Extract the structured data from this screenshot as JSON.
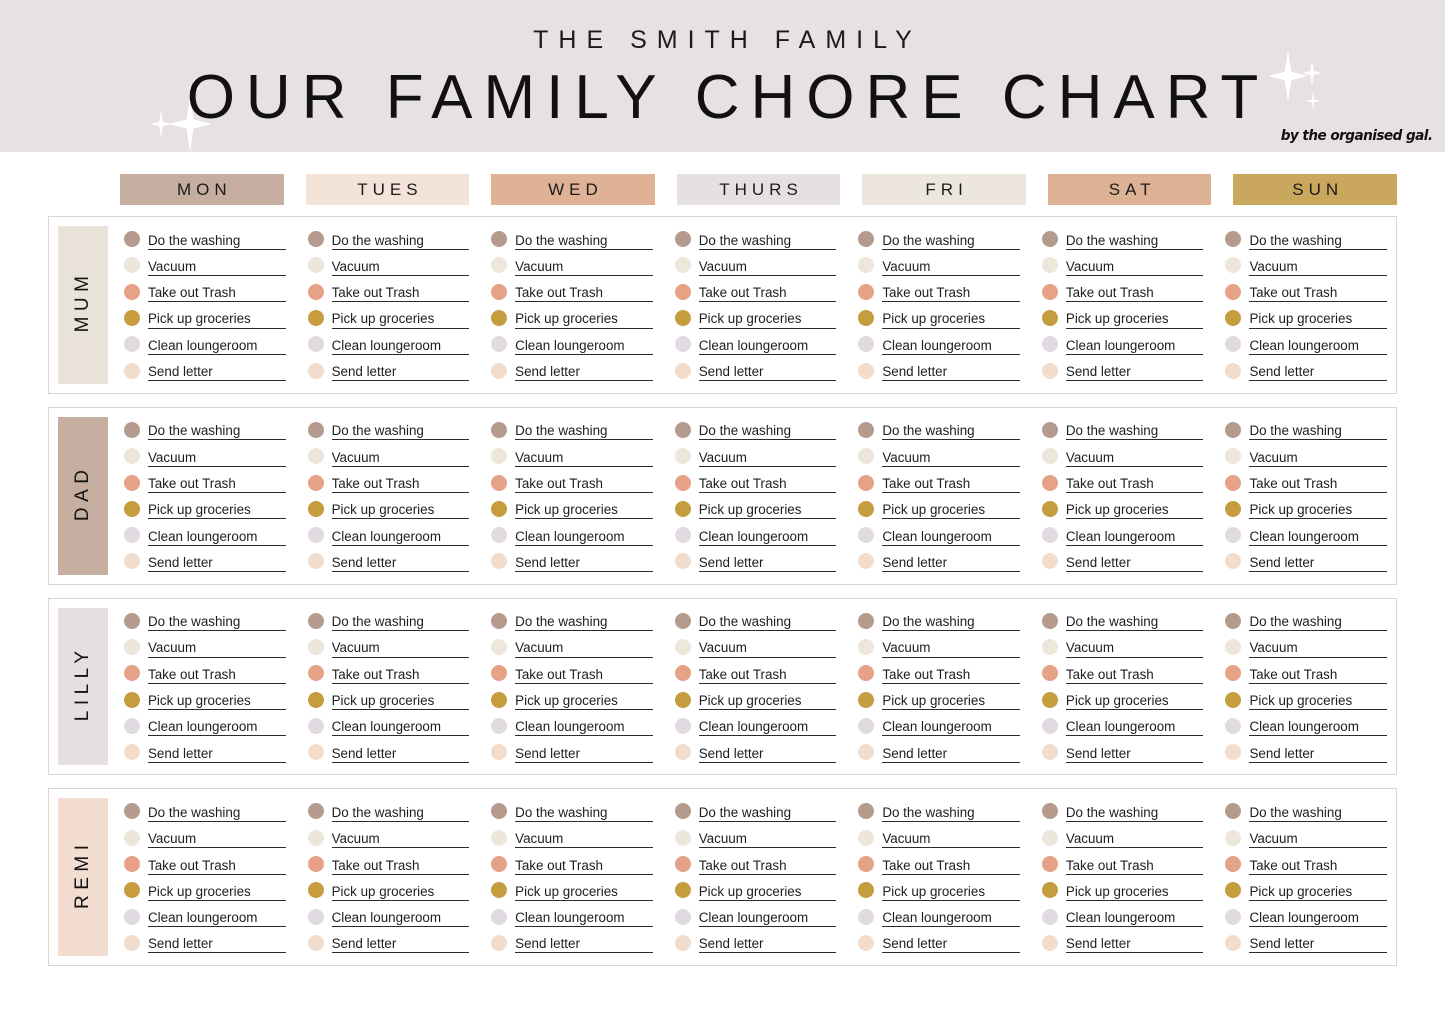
{
  "header": {
    "subtitle": "THE SMITH FAMILY",
    "title": "OUR FAMILY CHORE CHART",
    "brand": "by the organised gal.",
    "background_color": "#e7e1e4",
    "sparkle_color": "#ffffff"
  },
  "days": [
    {
      "label": "MON",
      "color": "#c5ad9f"
    },
    {
      "label": "TUES",
      "color": "#f3e3d9"
    },
    {
      "label": "WED",
      "color": "#dfb195"
    },
    {
      "label": "THURS",
      "color": "#e6e0e3"
    },
    {
      "label": "FRI",
      "color": "#ece6dd"
    },
    {
      "label": "SAT",
      "color": "#ddb194"
    },
    {
      "label": "SUN",
      "color": "#c9a85e"
    }
  ],
  "chores": [
    {
      "label": "Do the washing",
      "dot_color": "#b49b8e"
    },
    {
      "label": "Vacuum",
      "dot_color": "#ece6db"
    },
    {
      "label": "Take out Trash",
      "dot_color": "#e5a287"
    },
    {
      "label": "Pick up groceries",
      "dot_color": "#c59d3f"
    },
    {
      "label": "Clean loungeroom",
      "dot_color": "#e1dbe1"
    },
    {
      "label": "Send letter",
      "dot_color": "#f2ddcd"
    }
  ],
  "people": [
    {
      "name": "MUM",
      "tile_color": "#e8e2d8"
    },
    {
      "name": "DAD",
      "tile_color": "#c5ad9f"
    },
    {
      "name": "LILLY",
      "tile_color": "#e5dfe2"
    },
    {
      "name": "REMI",
      "tile_color": "#f2ddd0"
    }
  ],
  "card": {
    "border_color": "#e0d3d1",
    "line_color": "#2b2b2b"
  }
}
